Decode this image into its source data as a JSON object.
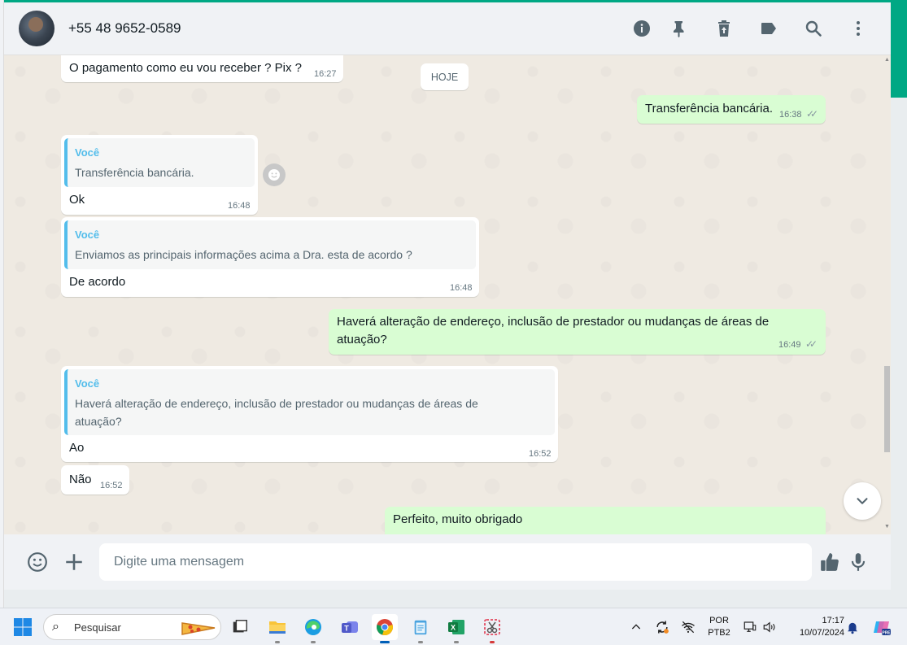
{
  "header": {
    "contact_name": "+55 48 9652-0589",
    "icons": [
      "info-icon",
      "pin-icon",
      "delete-icon",
      "label-icon",
      "search-icon",
      "menu-icon"
    ]
  },
  "chat": {
    "date_chip": "HOJE",
    "messages": [
      {
        "direction": "in",
        "text": "O pagamento como eu vou receber ? Pix ?",
        "time": "16:27"
      },
      {
        "direction": "out",
        "text": "Transferência bancária.",
        "time": "16:38",
        "status": "read"
      },
      {
        "direction": "in",
        "quote_author": "Você",
        "quote_text": "Transferência bancária.",
        "text": "Ok",
        "time": "16:48"
      },
      {
        "direction": "in",
        "quote_author": "Você",
        "quote_text": "Enviamos as principais informações acima a Dra. esta de acordo ?",
        "text": "De acordo",
        "time": "16:48"
      },
      {
        "direction": "out",
        "text_line1": "Haverá alteração de endereço, inclusão de prestador ou mudanças de áreas de",
        "text_line2": "atuação?",
        "time": "16:49",
        "status": "read"
      },
      {
        "direction": "in",
        "quote_author": "Você",
        "quote_line1": "Haverá alteração de endereço, inclusão de prestador ou mudanças de áreas de",
        "quote_line2": "atuação?",
        "text": "Ao",
        "time": "16:52"
      },
      {
        "direction": "in",
        "text": "Não",
        "time": "16:52"
      },
      {
        "direction": "out",
        "text": "Perfeito, muito obrigado"
      }
    ]
  },
  "composer": {
    "placeholder": "Digite uma mensagem"
  },
  "taskbar": {
    "search_label": "Pesquisar",
    "language_line1": "POR",
    "language_line2": "PTB2",
    "time": "17:17",
    "date": "10/07/2024"
  },
  "colors": {
    "accent": "#00a884",
    "outgoing_bubble": "#d9fdd3",
    "incoming_bubble": "#ffffff",
    "quote_bar": "#53bdeb",
    "chat_background": "#efeae2"
  }
}
